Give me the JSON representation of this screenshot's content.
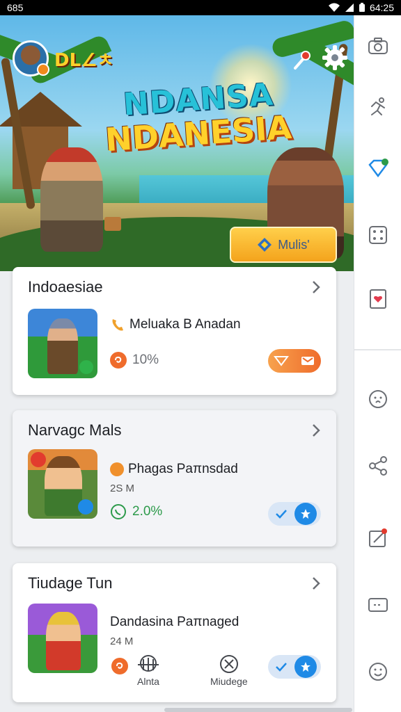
{
  "status_bar": {
    "left_text": "685",
    "time": "64:25"
  },
  "hero": {
    "logo_text": "DL∠ㅊ",
    "title_line1": "NDANSA",
    "title_line2": "NDANESIA",
    "cta_label": "Mulis'"
  },
  "cards": [
    {
      "title": "Indoaesiae",
      "line1": "Meluaka B Anadan",
      "line2": "",
      "percent": "10%",
      "toggle_style": "orange"
    },
    {
      "title": "Narvagc Mals",
      "line1": "Phagas Paπnsdad",
      "line2": "2S M",
      "percent": "2.0%",
      "toggle_style": "blue"
    },
    {
      "title": "Tiudage Tun",
      "line1": "Dandasina Paπnaged",
      "line2": "24 M",
      "percent": "",
      "toggle_style": "blue",
      "actions": [
        {
          "label": "Alnta",
          "icon": "network-icon"
        },
        {
          "label": "Miudege",
          "icon": "close-circle-icon"
        }
      ]
    }
  ],
  "rail_icons": [
    "camera-icon",
    "runner-icon",
    "diamond-icon",
    "dice-icon",
    "card-heart-icon",
    "face-icon",
    "share-icon",
    "edit-icon",
    "ticket-icon",
    "smile-icon"
  ],
  "colors": {
    "accent": "#1f8ae6",
    "orange": "#ef6c2c",
    "gold": "#ffd12b",
    "green": "#2c9a4a"
  }
}
